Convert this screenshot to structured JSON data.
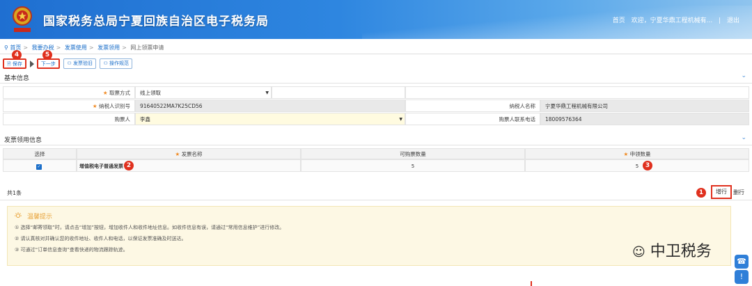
{
  "header": {
    "site_title": "国家税务总局宁夏回族自治区电子税务局",
    "links": [
      "首页",
      "欢迎，宁夏华鼎工程机械有...",
      "|",
      "退出"
    ]
  },
  "breadcrumb": [
    "首页",
    "我要办税",
    "发票使用",
    "发票领用",
    "网上领票申请"
  ],
  "toolbar": {
    "save": "保存",
    "next": "下一步",
    "return_invoice": "发票验旧",
    "guide": "操作规范"
  },
  "markers": [
    "1",
    "2",
    "3",
    "4",
    "5"
  ],
  "basic_info": {
    "title": "基本信息",
    "pickup_label": "取票方式",
    "pickup_value": "线上领取",
    "taxid_label": "纳税人识别号",
    "taxid_value": "91640522MA7K25CD56",
    "name_label": "纳税人名称",
    "name_value": "宁夏华鼎工程机械有限公司",
    "buyer_label": "购票人",
    "buyer_value": "李鑫",
    "phone_label": "购票人联系电话",
    "phone_value": "18009576364"
  },
  "invoice_section": {
    "title": "发票领用信息",
    "columns": [
      "选择",
      "发票名称",
      "可购票数量",
      "申领数量"
    ],
    "rows": [
      {
        "name": "增值税电子普通发票",
        "available": "5",
        "apply": "5"
      }
    ],
    "count": "共1条",
    "add": "增行",
    "delete": "删行"
  },
  "tips": {
    "title": "温馨提示",
    "lines": [
      "① 选择“邮寄领取”时，请点击“增加”按钮，增加收件人和收件地址信息。如收件信息有误，请通过“常用信息维护”进行修改。",
      "② 请认真核对并确认您的收件地址、收件人和电话，以保证发票准确及时送达。",
      "③ 可通过“订单信息查询”查看快递的物流跟踪轨迹。"
    ]
  },
  "watermark": "中卫税务",
  "colors": {
    "accent": "#1a6ec9",
    "marker": "#e0301e",
    "tips_bg": "#fdf8e4"
  }
}
